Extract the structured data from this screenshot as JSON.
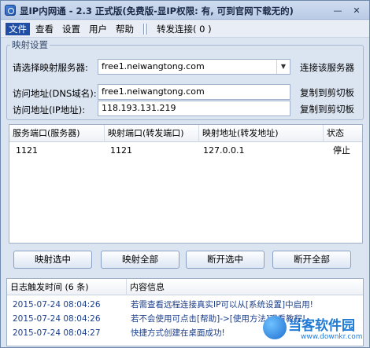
{
  "window": {
    "title": "显IP内网通 - 2.3 正式版(免费版-显IP权限: 有, 可到官网下载无的)",
    "minimize_glyph": "—",
    "close_glyph": "✕"
  },
  "menu": {
    "items": [
      "文件",
      "查看",
      "设置",
      "用户",
      "帮助"
    ],
    "separator": "||",
    "forward": "转发连接( 0 )",
    "active_index": 0
  },
  "mapping": {
    "group_title": "映射设置",
    "server_label": "请选择映射服务器:",
    "server_value": "free1.neiwangtong.com",
    "connect_button": "连接该服务器",
    "dns_label": "访问地址(DNS域名):",
    "dns_value": "free1.neiwangtong.com",
    "ip_label": "访问地址(IP地址):",
    "ip_value": "118.193.131.219",
    "copy_button": "复制到剪切板"
  },
  "table": {
    "columns": [
      "服务端口(服务器)",
      "映射端口(转发端口)",
      "映射地址(转发地址)",
      "状态"
    ],
    "rows": [
      [
        "1121",
        "1121",
        "127.0.0.1",
        "停止"
      ]
    ]
  },
  "actions": [
    "映射选中",
    "映射全部",
    "断开选中",
    "断开全部"
  ],
  "log": {
    "columns": [
      "日志触发时间 (6 条)",
      "内容信息"
    ],
    "rows": [
      {
        "time": "2015-07-24 08:04:26",
        "message": "若需查看远程连接真实IP可以从[系统设置]中启用!"
      },
      {
        "time": "2015-07-24 08:04:26",
        "message": "若不会使用可点击[帮助]->[使用方法]观看教程!"
      },
      {
        "time": "2015-07-24 08:04:27",
        "message": "快捷方式创建在桌面成功!"
      }
    ]
  },
  "watermark": {
    "main": "当客软件园",
    "sub": "www.downkr.com"
  },
  "colors": {
    "accent": "#1e4ea6",
    "log_text": "#1a3e8c",
    "watermark": "#1f7bd6"
  }
}
